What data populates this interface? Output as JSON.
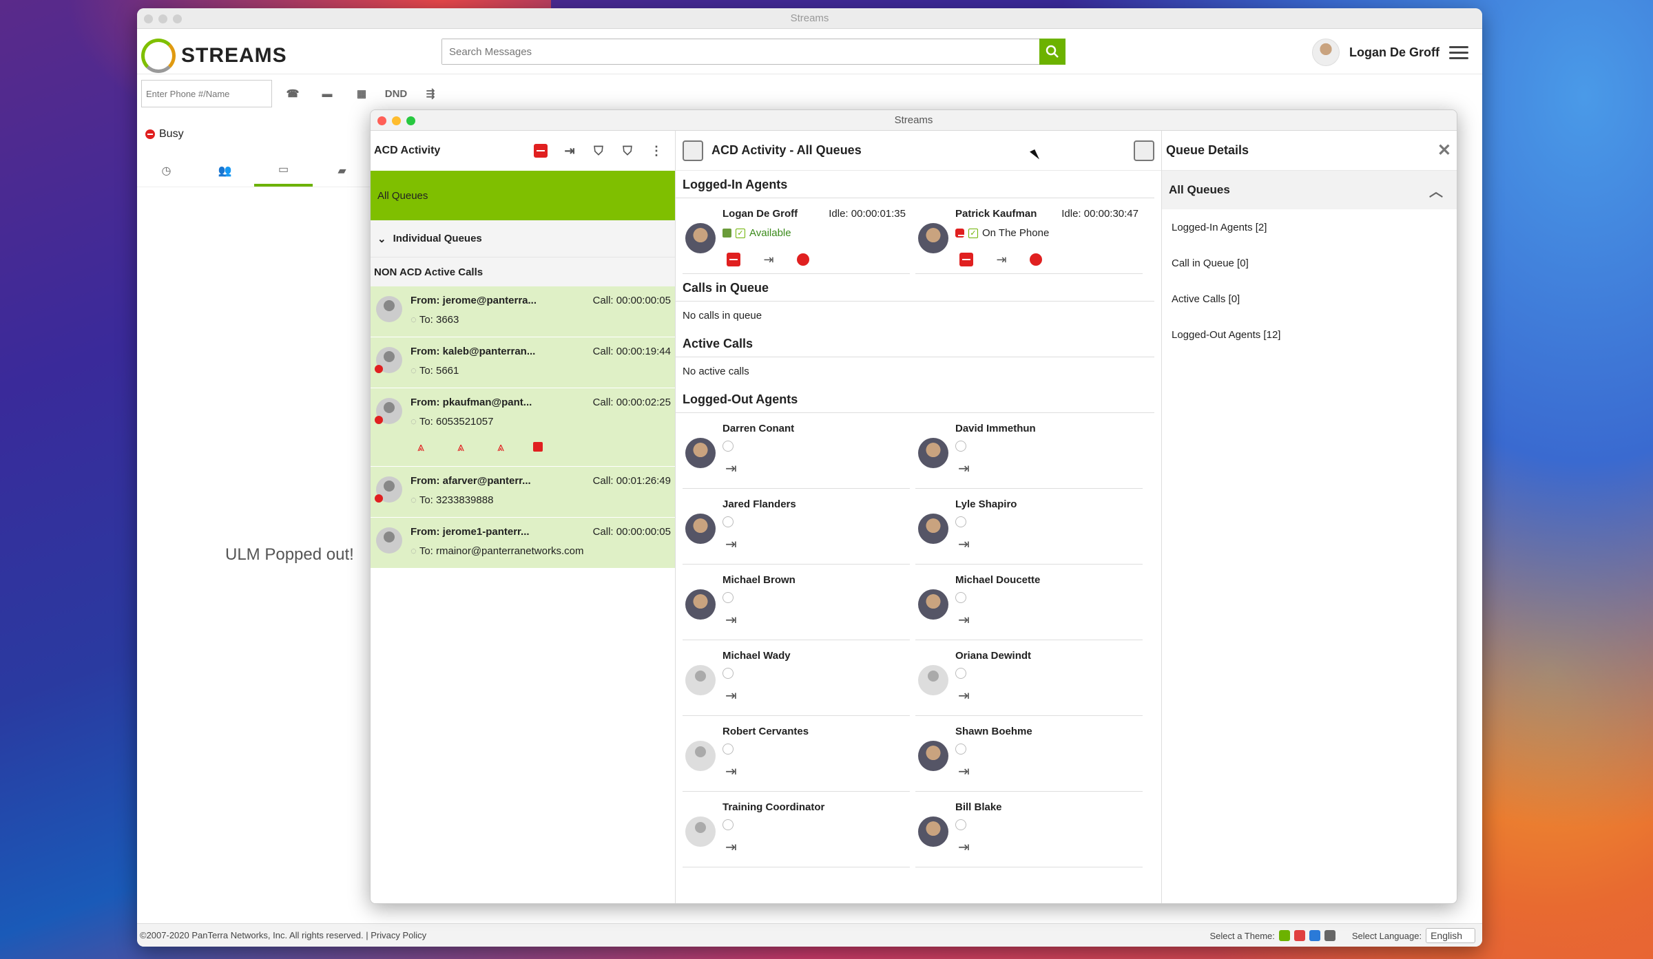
{
  "window_title": "Streams",
  "logo_text": "STREAMS",
  "search_placeholder": "Search Messages",
  "user_name": "Logan De Groff",
  "phone_placeholder": "Enter Phone #/Name",
  "dnd_label": "DND",
  "status": "Busy",
  "popped_text": "ULM Popped out!",
  "footer": {
    "copyright": "©2007-2020 PanTerra Networks, Inc. All rights reserved.  |  Privacy Policy",
    "theme_label": "Select a Theme:",
    "language_label": "Select Language:",
    "language": "English",
    "theme_colors": [
      "#6cb200",
      "#e04040",
      "#2a7ad8",
      "#666666"
    ]
  },
  "popup": {
    "title": "Streams",
    "acd_title": "ACD Activity",
    "all_queues": "All Queues",
    "individual_queues": "Individual Queues",
    "non_acd": "NON ACD Active Calls",
    "calls": [
      {
        "from": "From: jerome@panterra...",
        "time": "Call: 00:00:00:05",
        "to": "To: 3663"
      },
      {
        "from": "From: kaleb@panterran...",
        "time": "Call: 00:00:19:44",
        "to": "To: 5661"
      },
      {
        "from": "From: pkaufman@pant...",
        "time": "Call: 00:00:02:25",
        "to": "To: 6053521057"
      },
      {
        "from": "From: afarver@panterr...",
        "time": "Call: 00:01:26:49",
        "to": "To: 3233839888"
      },
      {
        "from": "From: jerome1-panterr...",
        "time": "Call: 00:00:00:05",
        "to": "To: rmainor@panterranetworks.com"
      }
    ],
    "main_title": "ACD Activity - All Queues",
    "logged_in_title": "Logged-In Agents",
    "logged_in": [
      {
        "name": "Logan De Groff",
        "idle": "Idle: 00:00:01:35",
        "status": "Available"
      },
      {
        "name": "Patrick Kaufman",
        "idle": "Idle: 00:00:30:47",
        "status": "On The Phone"
      }
    ],
    "calls_in_queue_title": "Calls in Queue",
    "no_calls": "No calls in queue",
    "active_calls_title": "Active Calls",
    "no_active": "No active calls",
    "logged_out_title": "Logged-Out Agents",
    "logged_out": [
      "Darren Conant",
      "David Immethun",
      "Jared Flanders",
      "Lyle Shapiro",
      "Michael Brown",
      "Michael Doucette",
      "Michael Wady",
      "Oriana Dewindt",
      "Robert Cervantes",
      "Shawn Boehme",
      "Training Coordinator",
      "Bill Blake"
    ],
    "queue_details_title": "Queue Details",
    "qd_all": "All Queues",
    "qd_items": [
      "Logged-In Agents  [2]",
      "Call in Queue  [0]",
      "Active Calls  [0]",
      "Logged-Out Agents  [12]"
    ]
  }
}
